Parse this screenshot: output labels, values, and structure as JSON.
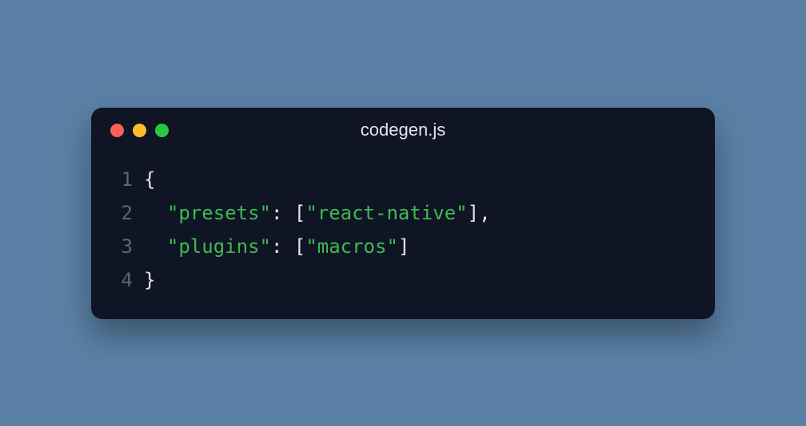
{
  "title": "codegen.js",
  "traffic_lights": {
    "close_color": "#FF5F56",
    "minimize_color": "#FFBD2E",
    "maximize_color": "#27C93F"
  },
  "code": {
    "lines": [
      {
        "lineno": "1"
      },
      {
        "lineno": "2"
      },
      {
        "lineno": "3"
      },
      {
        "lineno": "4"
      }
    ],
    "tokens": {
      "open_brace": "{",
      "close_brace": "}",
      "indent": "  ",
      "key1": "\"presets\"",
      "colon_space": ": ",
      "open_bracket": "[",
      "val1": "\"react-native\"",
      "close_bracket": "]",
      "comma": ",",
      "key2": "\"plugins\"",
      "val2": "\"macros\""
    }
  }
}
